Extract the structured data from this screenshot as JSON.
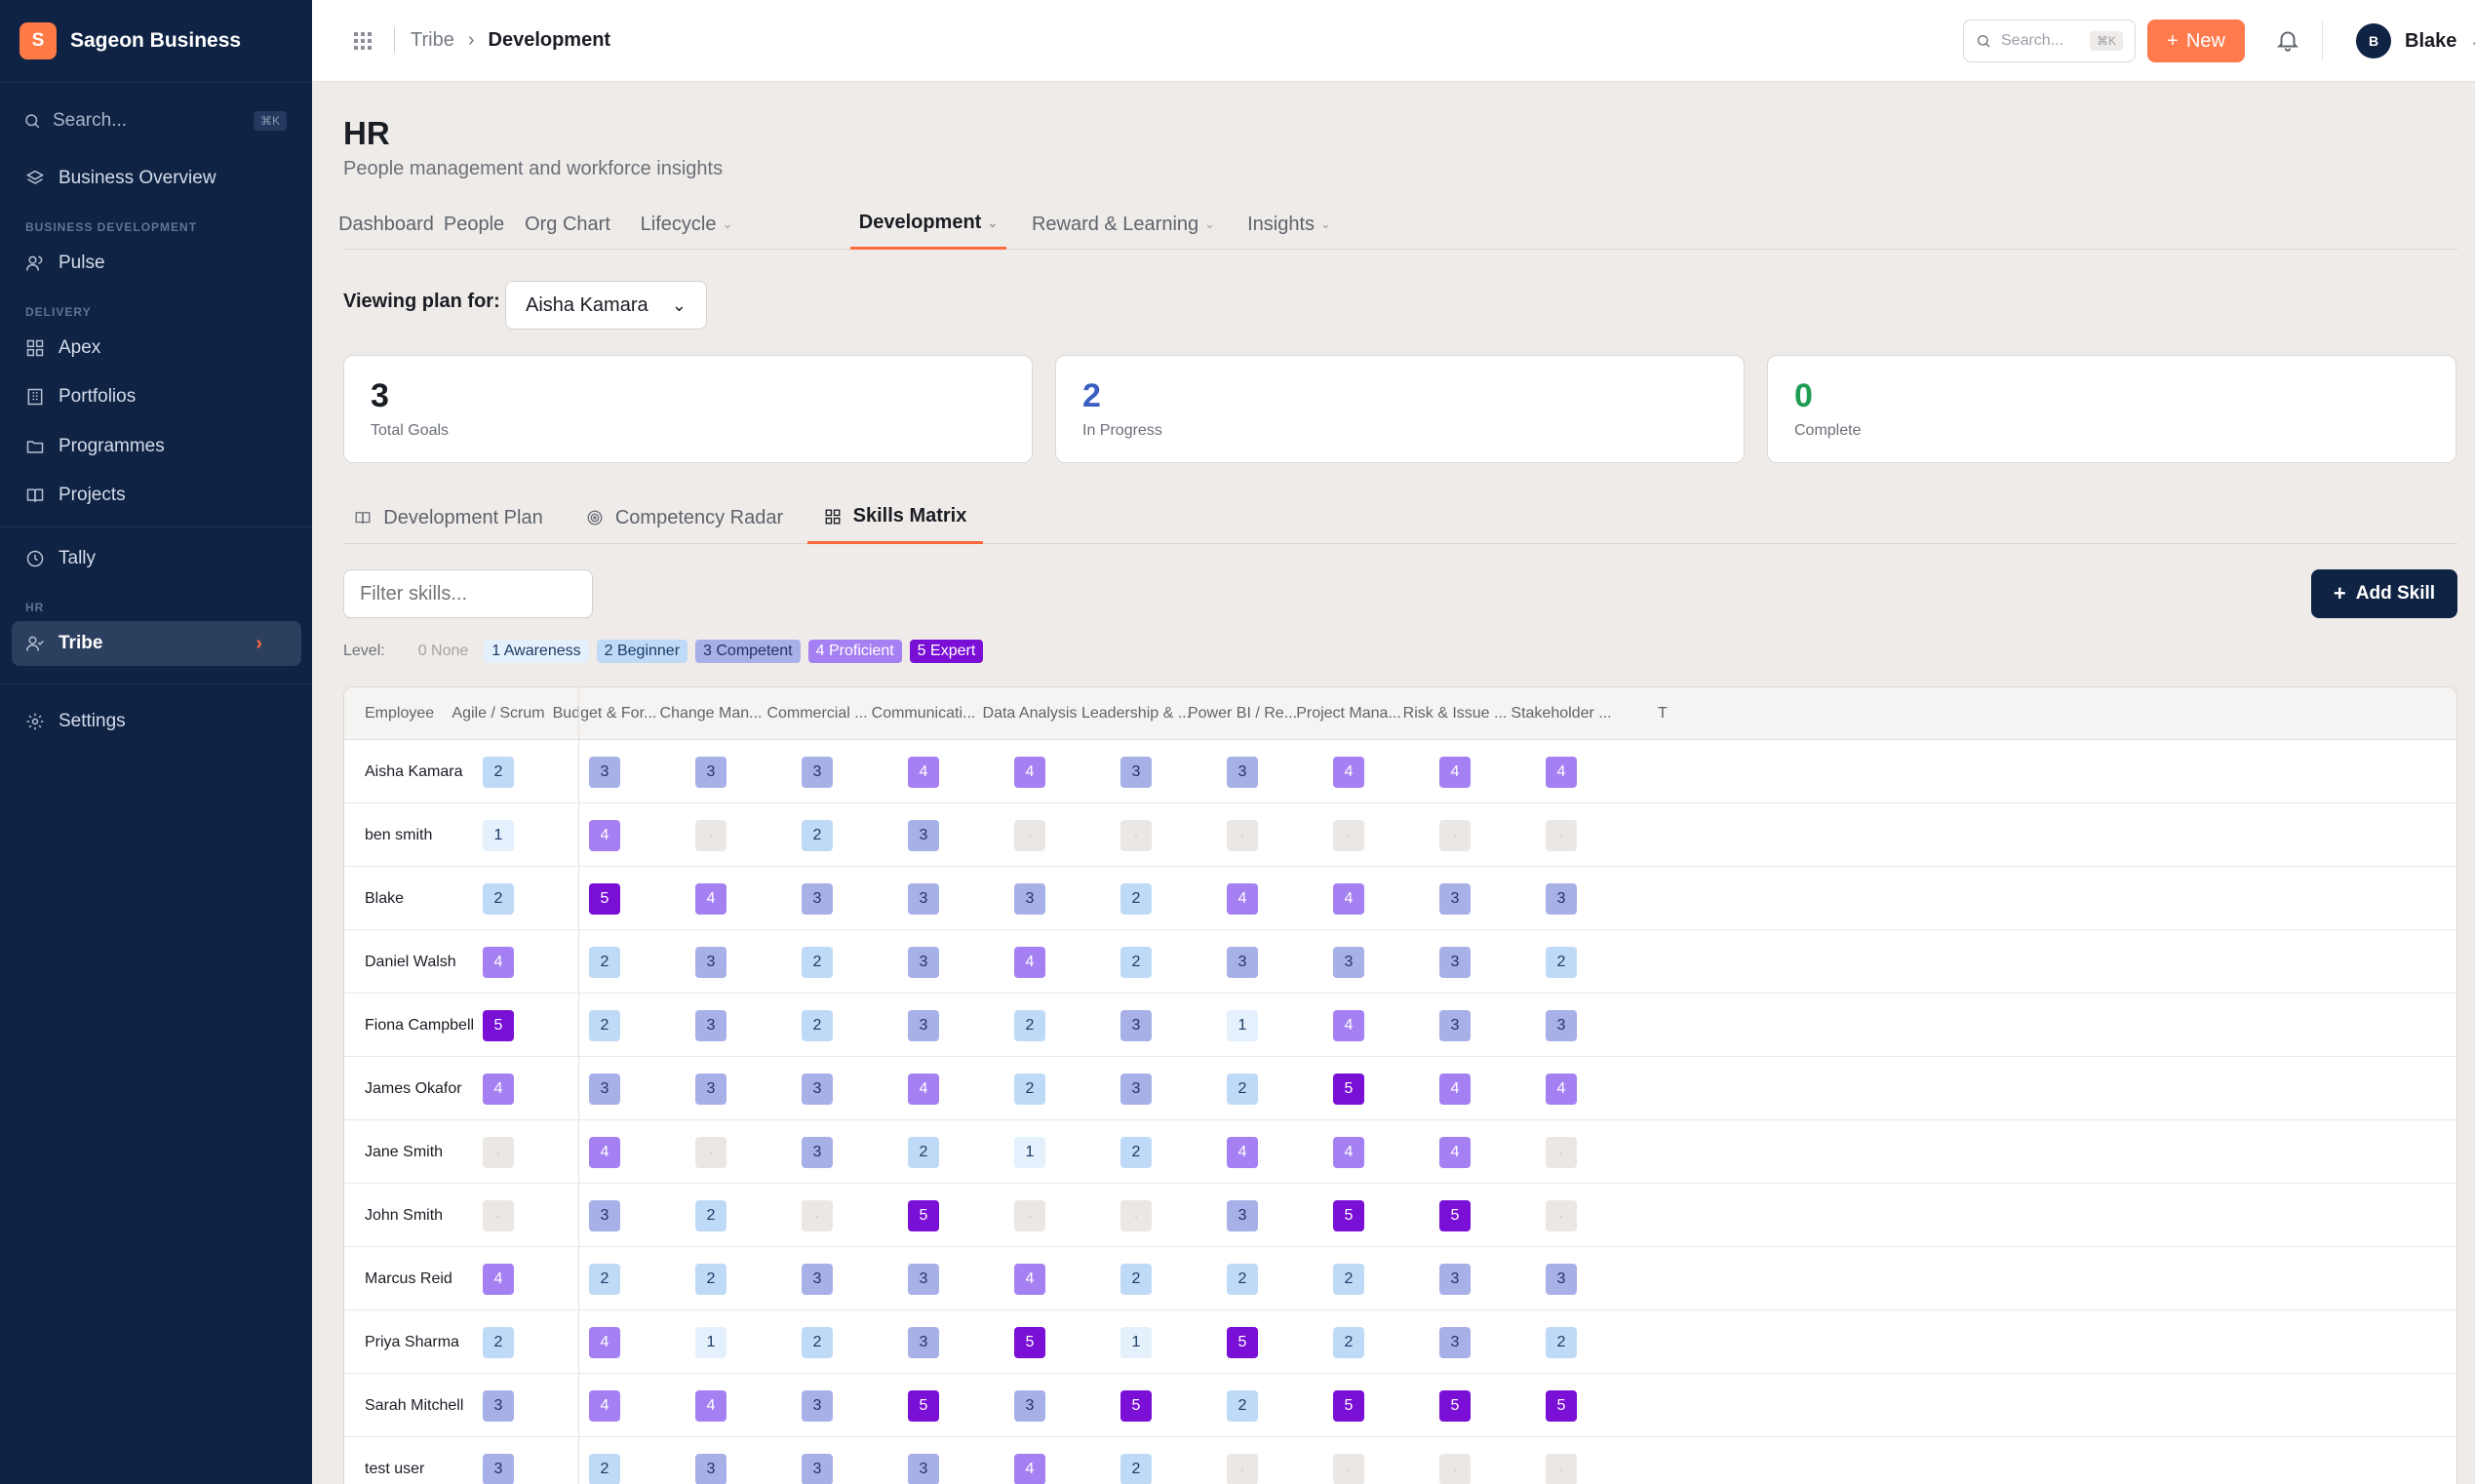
{
  "brand": {
    "initial": "S",
    "name": "Sageon Business"
  },
  "sidebar": {
    "search_placeholder": "Search...",
    "search_shortcut": "⌘K",
    "business_overview": "Business Overview",
    "section_business_dev": "BUSINESS DEVELOPMENT",
    "pulse": "Pulse",
    "section_delivery": "DELIVERY",
    "apex": "Apex",
    "portfolios": "Portfolios",
    "programmes": "Programmes",
    "projects": "Projects",
    "tally": "Tally",
    "section_hr": "HR",
    "tribe": "Tribe",
    "settings": "Settings"
  },
  "topbar": {
    "crumb_parent": "Tribe",
    "crumb_current": "Development",
    "search_placeholder": "Search...",
    "search_shortcut": "⌘K",
    "new_label": "New",
    "user_initial": "B",
    "user_name": "Blake"
  },
  "page": {
    "title": "HR",
    "subtitle": "People management and workforce insights"
  },
  "tabs": [
    "Dashboard",
    "People",
    "Org Chart",
    "Lifecycle",
    "Development",
    "Reward & Learning",
    "Insights"
  ],
  "viewing": {
    "label": "Viewing plan for:",
    "selected": "Aisha Kamara"
  },
  "stats": [
    {
      "value": "3",
      "label": "Total Goals",
      "color": "#1a1d24"
    },
    {
      "value": "2",
      "label": "In Progress",
      "color": "#3b5fc0"
    },
    {
      "value": "0",
      "label": "Complete",
      "color": "#1f9d55"
    }
  ],
  "subtabs": [
    "Development Plan",
    "Competency Radar",
    "Skills Matrix"
  ],
  "filter_placeholder": "Filter skills...",
  "add_skill_label": "Add Skill",
  "legend": {
    "label": "Level:",
    "items": [
      "0 None",
      "1 Awareness",
      "2 Beginner",
      "3 Competent",
      "4 Proficient",
      "5 Expert"
    ]
  },
  "level_colors": {
    "0": "#ebe7e4",
    "1": "#e4f0fb",
    "2": "#bfdaf7",
    "3": "#a8b0e8",
    "4": "#a580f2",
    "5": "#7a0fd6"
  },
  "empty_marker": "·",
  "matrix": {
    "employee_header": "Employee",
    "skills": [
      "Agile / Scrum",
      "Budget & For...",
      "Change Man...",
      "Commercial ...",
      "Communicati...",
      "Data Analysis",
      "Leadership & ...",
      "Power BI / Re...",
      "Project Mana...",
      "Risk & Issue ...",
      "Stakeholder ...",
      "T"
    ],
    "rows": [
      {
        "name": "Aisha Kamara",
        "levels": [
          2,
          3,
          3,
          3,
          4,
          4,
          3,
          3,
          4,
          4,
          4
        ]
      },
      {
        "name": "ben smith",
        "levels": [
          1,
          4,
          0,
          2,
          3,
          0,
          0,
          0,
          0,
          0,
          0
        ]
      },
      {
        "name": "Blake",
        "levels": [
          2,
          5,
          4,
          3,
          3,
          3,
          2,
          4,
          4,
          3,
          3
        ]
      },
      {
        "name": "Daniel Walsh",
        "levels": [
          4,
          2,
          3,
          2,
          3,
          4,
          2,
          3,
          3,
          3,
          2
        ]
      },
      {
        "name": "Fiona Campbell",
        "levels": [
          5,
          2,
          3,
          2,
          3,
          2,
          3,
          1,
          4,
          3,
          3
        ]
      },
      {
        "name": "James Okafor",
        "levels": [
          4,
          3,
          3,
          3,
          4,
          2,
          3,
          2,
          5,
          4,
          4
        ]
      },
      {
        "name": "Jane Smith",
        "levels": [
          0,
          4,
          0,
          3,
          2,
          1,
          2,
          4,
          4,
          4,
          0
        ]
      },
      {
        "name": "John Smith",
        "levels": [
          0,
          3,
          2,
          0,
          5,
          0,
          0,
          3,
          5,
          5,
          0
        ]
      },
      {
        "name": "Marcus Reid",
        "levels": [
          4,
          2,
          2,
          3,
          3,
          4,
          2,
          2,
          2,
          3,
          3
        ]
      },
      {
        "name": "Priya Sharma",
        "levels": [
          2,
          4,
          1,
          2,
          3,
          5,
          1,
          5,
          2,
          3,
          2
        ]
      },
      {
        "name": "Sarah Mitchell",
        "levels": [
          3,
          4,
          4,
          3,
          5,
          3,
          5,
          2,
          5,
          5,
          5
        ]
      },
      {
        "name": "test user",
        "levels": [
          3,
          2,
          3,
          3,
          3,
          4,
          2,
          0,
          0,
          0,
          0
        ]
      }
    ]
  }
}
